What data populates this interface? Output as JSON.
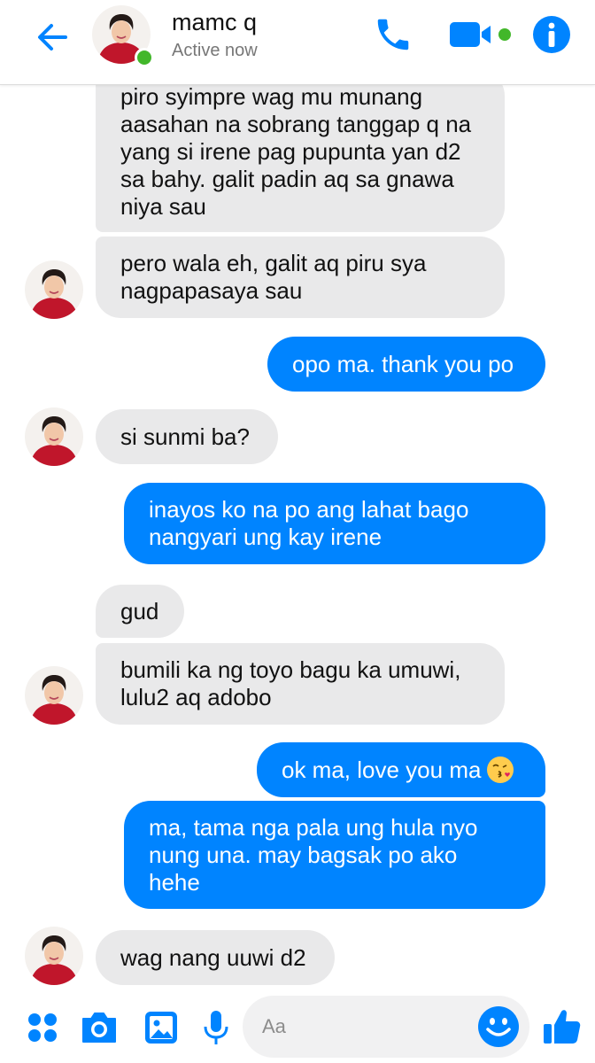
{
  "header": {
    "contact_name": "mamc q",
    "status": "Active now"
  },
  "icons": {
    "back": "arrow-left-icon",
    "call": "phone-icon",
    "video": "video-camera-icon",
    "info": "info-icon",
    "apps": "apps-grid-icon",
    "camera": "camera-icon",
    "gallery": "image-icon",
    "mic": "microphone-icon",
    "emoji": "smiley-icon",
    "like": "thumbs-up-icon"
  },
  "colors": {
    "accent": "#0084ff",
    "incoming_bubble": "#e9e9ea",
    "online": "#42b72a"
  },
  "messages": [
    {
      "from": "them",
      "text": "piro syimpre wag mu munang\naasahan na sobrang tanggap q na\nyang si irene pag pupunta yan d2\nsa bahy. galit padin aq sa gnawa\nniya sau"
    },
    {
      "from": "them",
      "text": "pero wala eh, galit aq piru sya\nnagpapasaya sau"
    },
    {
      "from": "me",
      "text": "opo ma. thank you po"
    },
    {
      "from": "them",
      "text": "si sunmi ba?"
    },
    {
      "from": "me",
      "text": "inayos ko na po ang lahat bago\nnangyari ung kay irene"
    },
    {
      "from": "them",
      "text": "gud"
    },
    {
      "from": "them",
      "text": "bumili ka ng toyo bagu ka umuwi,\nlulu2 aq adobo"
    },
    {
      "from": "me",
      "text": "ok ma, love you ma",
      "emoji": "face-blowing-a-kiss"
    },
    {
      "from": "me",
      "text": "ma, tama nga pala ung hula nyo\nnung una. may bagsak po ako\nhehe"
    },
    {
      "from": "them",
      "text": "wag nang uuwi d2"
    }
  ],
  "composer": {
    "placeholder": "Aa",
    "value": ""
  }
}
